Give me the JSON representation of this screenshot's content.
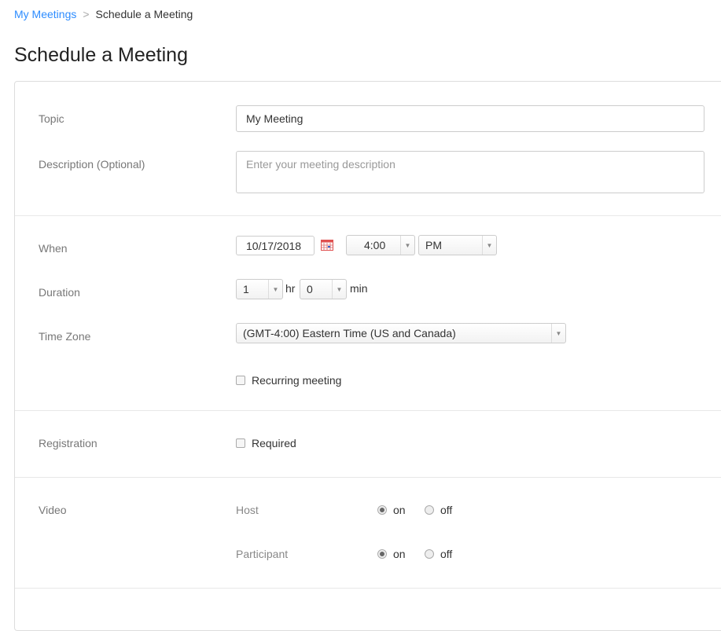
{
  "breadcrumb": {
    "parent": "My Meetings",
    "separator": ">",
    "current": "Schedule a Meeting"
  },
  "page_title": "Schedule a Meeting",
  "form": {
    "topic": {
      "label": "Topic",
      "value": "My Meeting"
    },
    "description": {
      "label": "Description (Optional)",
      "placeholder": "Enter your meeting description"
    },
    "when": {
      "label": "When",
      "date": "10/17/2018",
      "time": "4:00",
      "ampm": "PM"
    },
    "duration": {
      "label": "Duration",
      "hours": "1",
      "hr_unit": "hr",
      "minutes": "0",
      "min_unit": "min"
    },
    "timezone": {
      "label": "Time Zone",
      "value": "(GMT-4:00) Eastern Time (US and Canada)"
    },
    "recurring": {
      "label": "Recurring meeting",
      "checked": false
    },
    "registration": {
      "label": "Registration",
      "option": "Required",
      "checked": false
    },
    "video": {
      "label": "Video",
      "host": {
        "label": "Host",
        "on": "on",
        "off": "off",
        "selected": "on"
      },
      "participant": {
        "label": "Participant",
        "on": "on",
        "off": "off",
        "selected": "on"
      }
    }
  },
  "colors": {
    "link": "#2d8cff",
    "calendar_icon": "#e05050"
  }
}
